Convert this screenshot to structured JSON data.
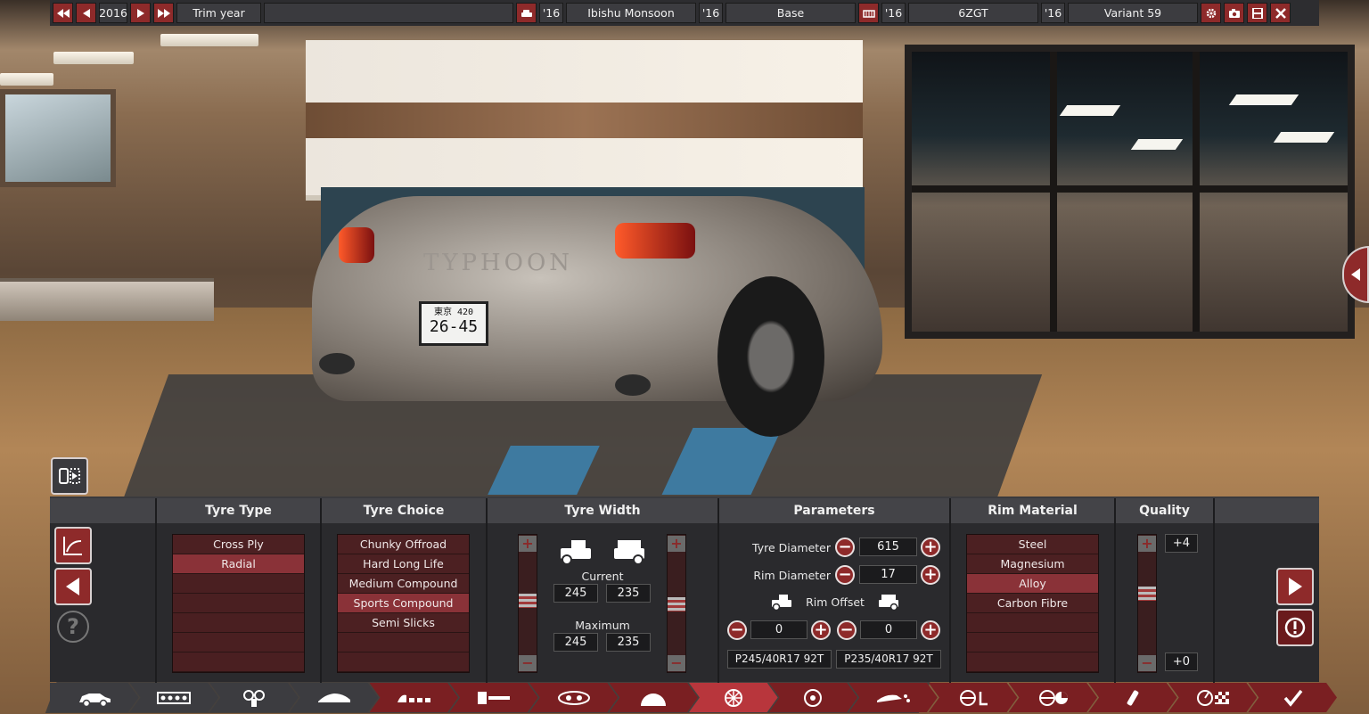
{
  "topbar": {
    "year": "2016",
    "trim_year_label": "Trim year",
    "model_year": "'16",
    "model_name": "Ibishu Monsoon",
    "trim_year": "'16",
    "trim_name": "Base",
    "engine_year": "'16",
    "engine_name": "6ZGT",
    "variant_year": "'16",
    "variant_name": "Variant 59"
  },
  "scene": {
    "plate_line1": "東京 420",
    "plate_line2": "26-45",
    "car_badge": "TYPHOON"
  },
  "panel": {
    "tyre_type": {
      "header": "Tyre Type",
      "items": [
        "Cross Ply",
        "Radial",
        "",
        "",
        "",
        "",
        ""
      ],
      "selected": "Radial"
    },
    "tyre_choice": {
      "header": "Tyre Choice",
      "items": [
        "Chunky Offroad",
        "Hard Long Life",
        "Medium Compound",
        "Sports Compound",
        "Semi Slicks",
        "",
        ""
      ],
      "selected": "Sports Compound"
    },
    "tyre_width": {
      "header": "Tyre Width",
      "current_label": "Current",
      "current_front": "245",
      "current_rear": "235",
      "maximum_label": "Maximum",
      "maximum_front": "245",
      "maximum_rear": "235"
    },
    "parameters": {
      "header": "Parameters",
      "tyre_diameter_label": "Tyre Diameter",
      "tyre_diameter": "615",
      "rim_diameter_label": "Rim Diameter",
      "rim_diameter": "17",
      "rim_offset_label": "Rim Offset",
      "rim_offset_front": "0",
      "rim_offset_rear": "0",
      "tyre_code_front": "P245/40R17 92T",
      "tyre_code_rear": "P235/40R17 92T"
    },
    "rim_material": {
      "header": "Rim Material",
      "items": [
        "Steel",
        "Magnesium",
        "Alloy",
        "Carbon Fibre",
        "",
        "",
        ""
      ],
      "selected": "Alloy"
    },
    "quality": {
      "header": "Quality",
      "top_value": "+4",
      "bottom_value": "+0"
    }
  },
  "colors": {
    "accent": "#8e2a2a",
    "selected_row": "#8a3238",
    "panel_bg": "#2a2a2d"
  }
}
